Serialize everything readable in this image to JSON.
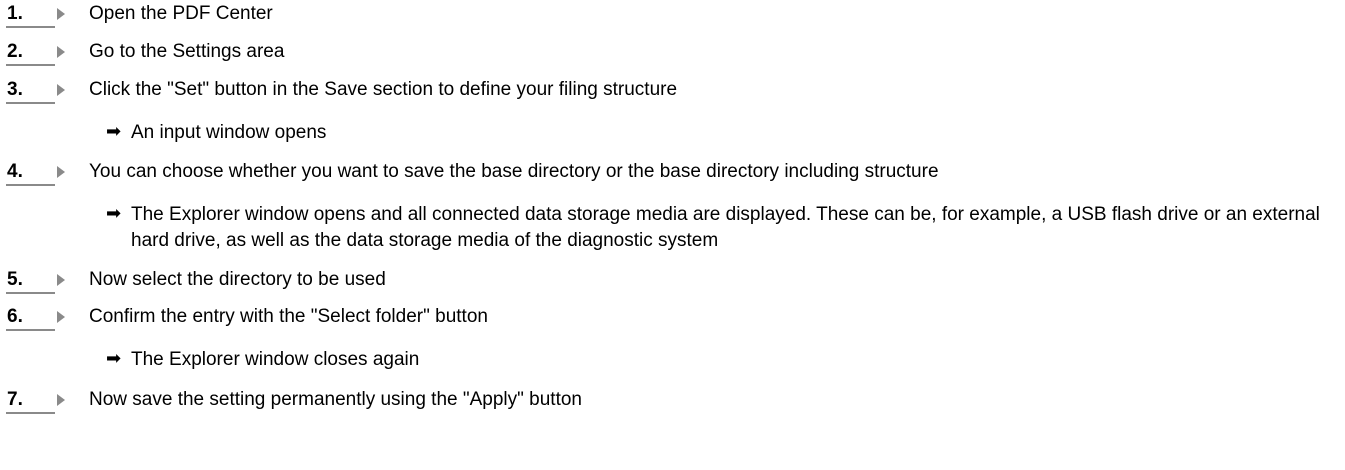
{
  "steps": [
    {
      "number": "1.",
      "text": "Open the PDF Center"
    },
    {
      "number": "2.",
      "text": "Go to the Settings area"
    },
    {
      "number": "3.",
      "text": "Click the \"Set\" button in the Save section to define your filing structure"
    },
    {
      "number": "4.",
      "text": "You can choose whether you want to save the base directory or the base directory including structure"
    },
    {
      "number": "5.",
      "text": "Now select the directory to be used"
    },
    {
      "number": "6.",
      "text": "Confirm the entry with the \"Select folder\" button"
    },
    {
      "number": "7.",
      "text": "Now save the setting permanently using the \"Apply\" button"
    }
  ],
  "results": [
    {
      "icon": "right-arrow-icon",
      "text": "An input window opens"
    },
    {
      "icon": "right-arrow-icon",
      "text": "The Explorer window opens and all connected data storage media are displayed. These can be, for example, a USB flash drive or an external hard drive, as well as the data storage media of the diagnostic system"
    },
    {
      "icon": "right-arrow-icon",
      "text": "The Explorer window closes again"
    }
  ]
}
